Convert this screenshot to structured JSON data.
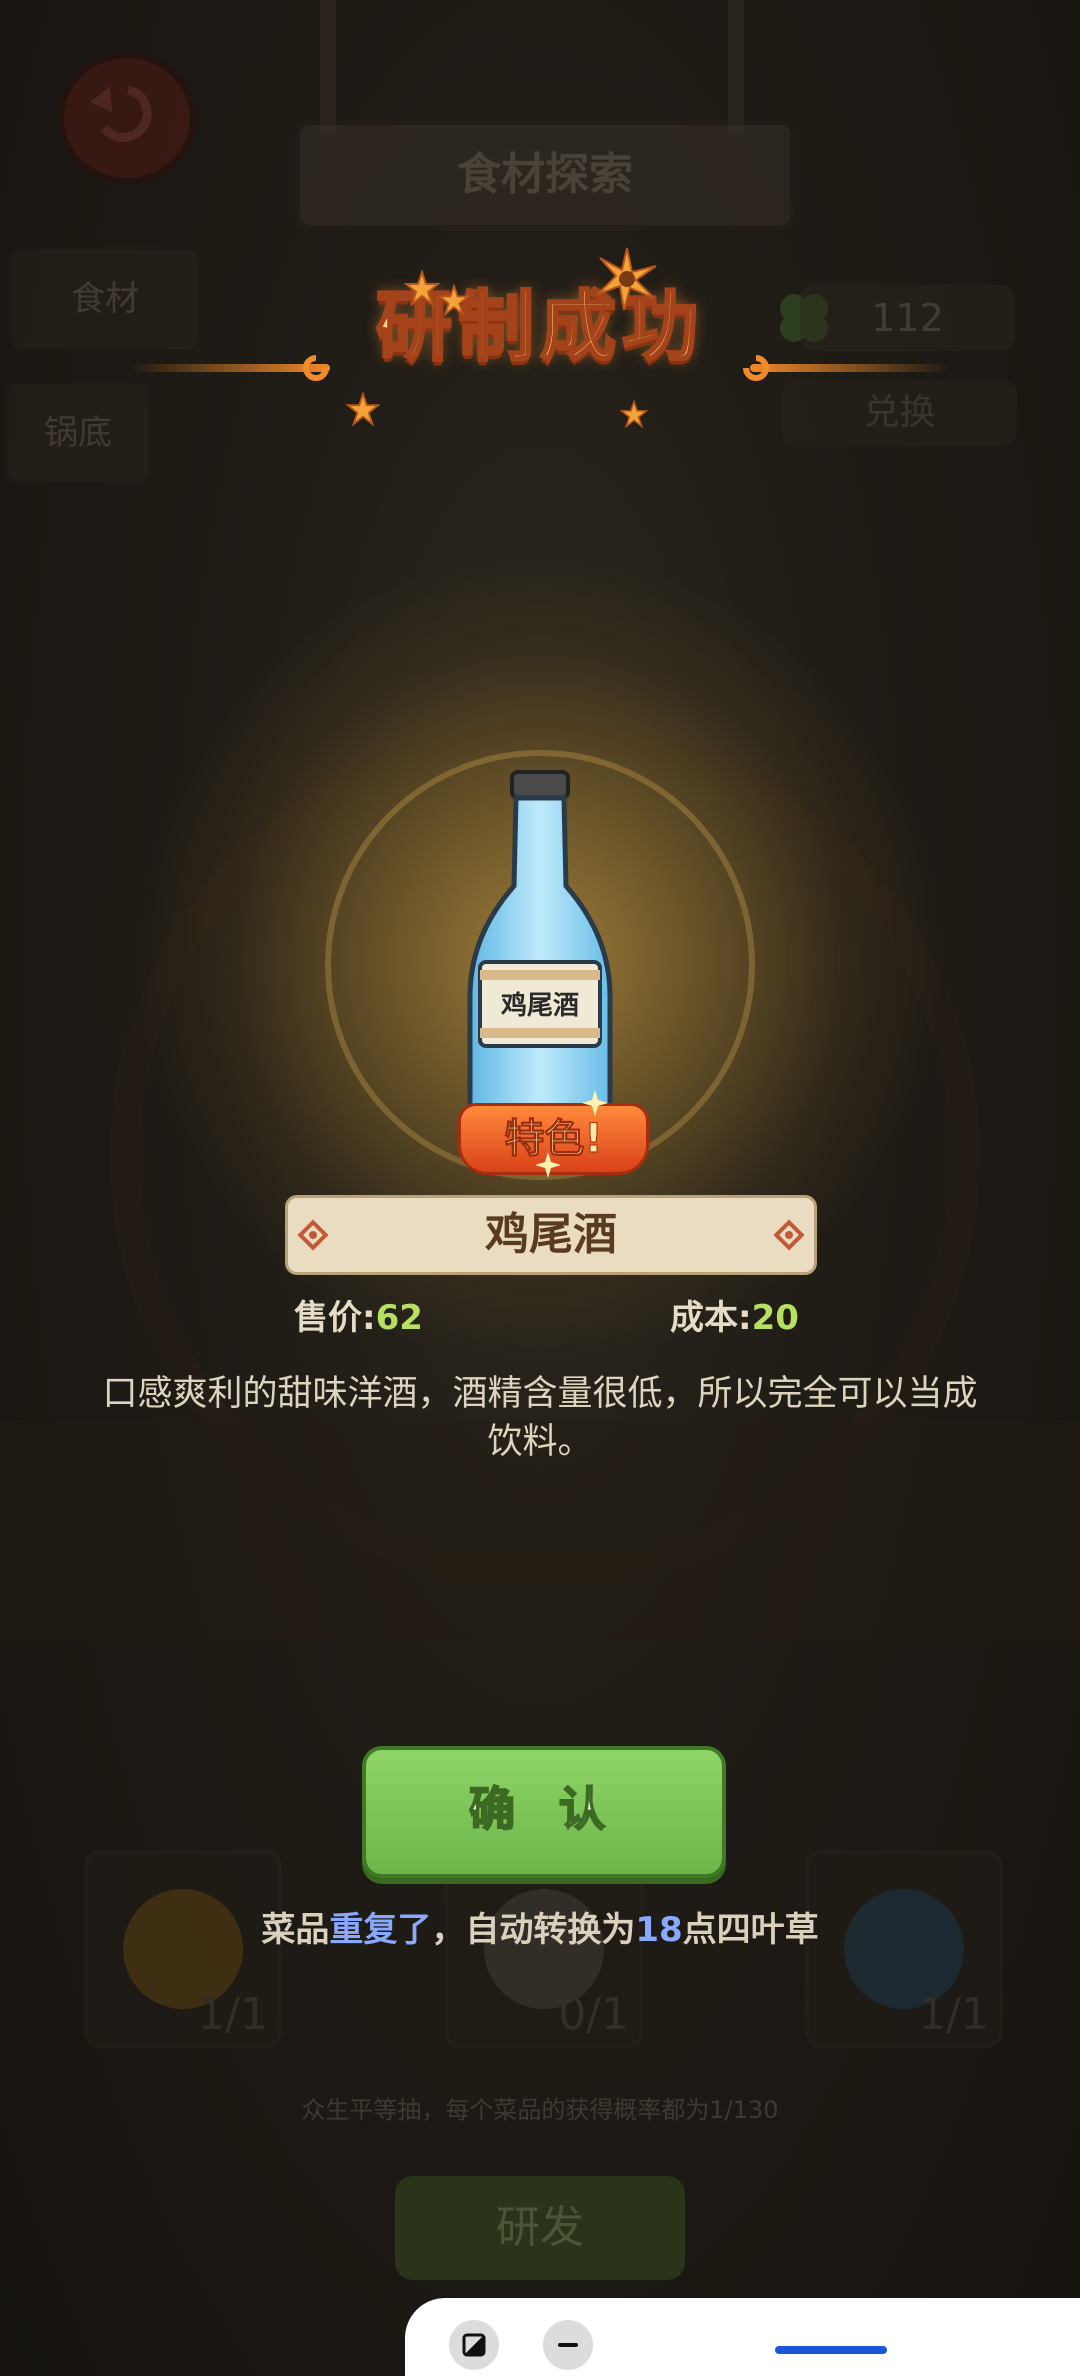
{
  "background": {
    "header_title": "食材探索",
    "tab_ingredients": "食材",
    "tab_pot_base": "锅底",
    "clover_count": "112",
    "exchange_label": "兑换",
    "slots": [
      {
        "count": "1/1"
      },
      {
        "count": "0/1"
      },
      {
        "count": "1/1"
      }
    ],
    "probability_hint": "众生平等抽，每个菜品的获得概率都为1/130",
    "develop_button": "研发"
  },
  "popup": {
    "title": "研制成功",
    "item": {
      "bottle_label": "鸡尾酒",
      "badge": "特色!",
      "name": "鸡尾酒",
      "price_label": "售价",
      "price_sep": ":",
      "price_value": "62",
      "cost_label": "成本",
      "cost_sep": ":",
      "cost_value": "20",
      "description": "口感爽利的甜味洋酒，酒精含量很低，所以完全可以当成饮料。"
    },
    "confirm_button": "确 认",
    "notice": {
      "part1": "菜品",
      "part2": "重复了",
      "part3": "，自动转换为",
      "part4": "18",
      "part5": "点四叶草"
    }
  },
  "colors": {
    "title_fill": "#ffd28a",
    "confirm_green": "#7cc55a",
    "highlight_blue": "#8aa8ff",
    "value_green": "#b7e062"
  },
  "icons": [
    "back-arrow-icon",
    "clover-icon",
    "sparkle-star-icon",
    "bottle-icon",
    "diamond-ornament-icon",
    "screenshot-icon",
    "minimize-icon"
  ]
}
